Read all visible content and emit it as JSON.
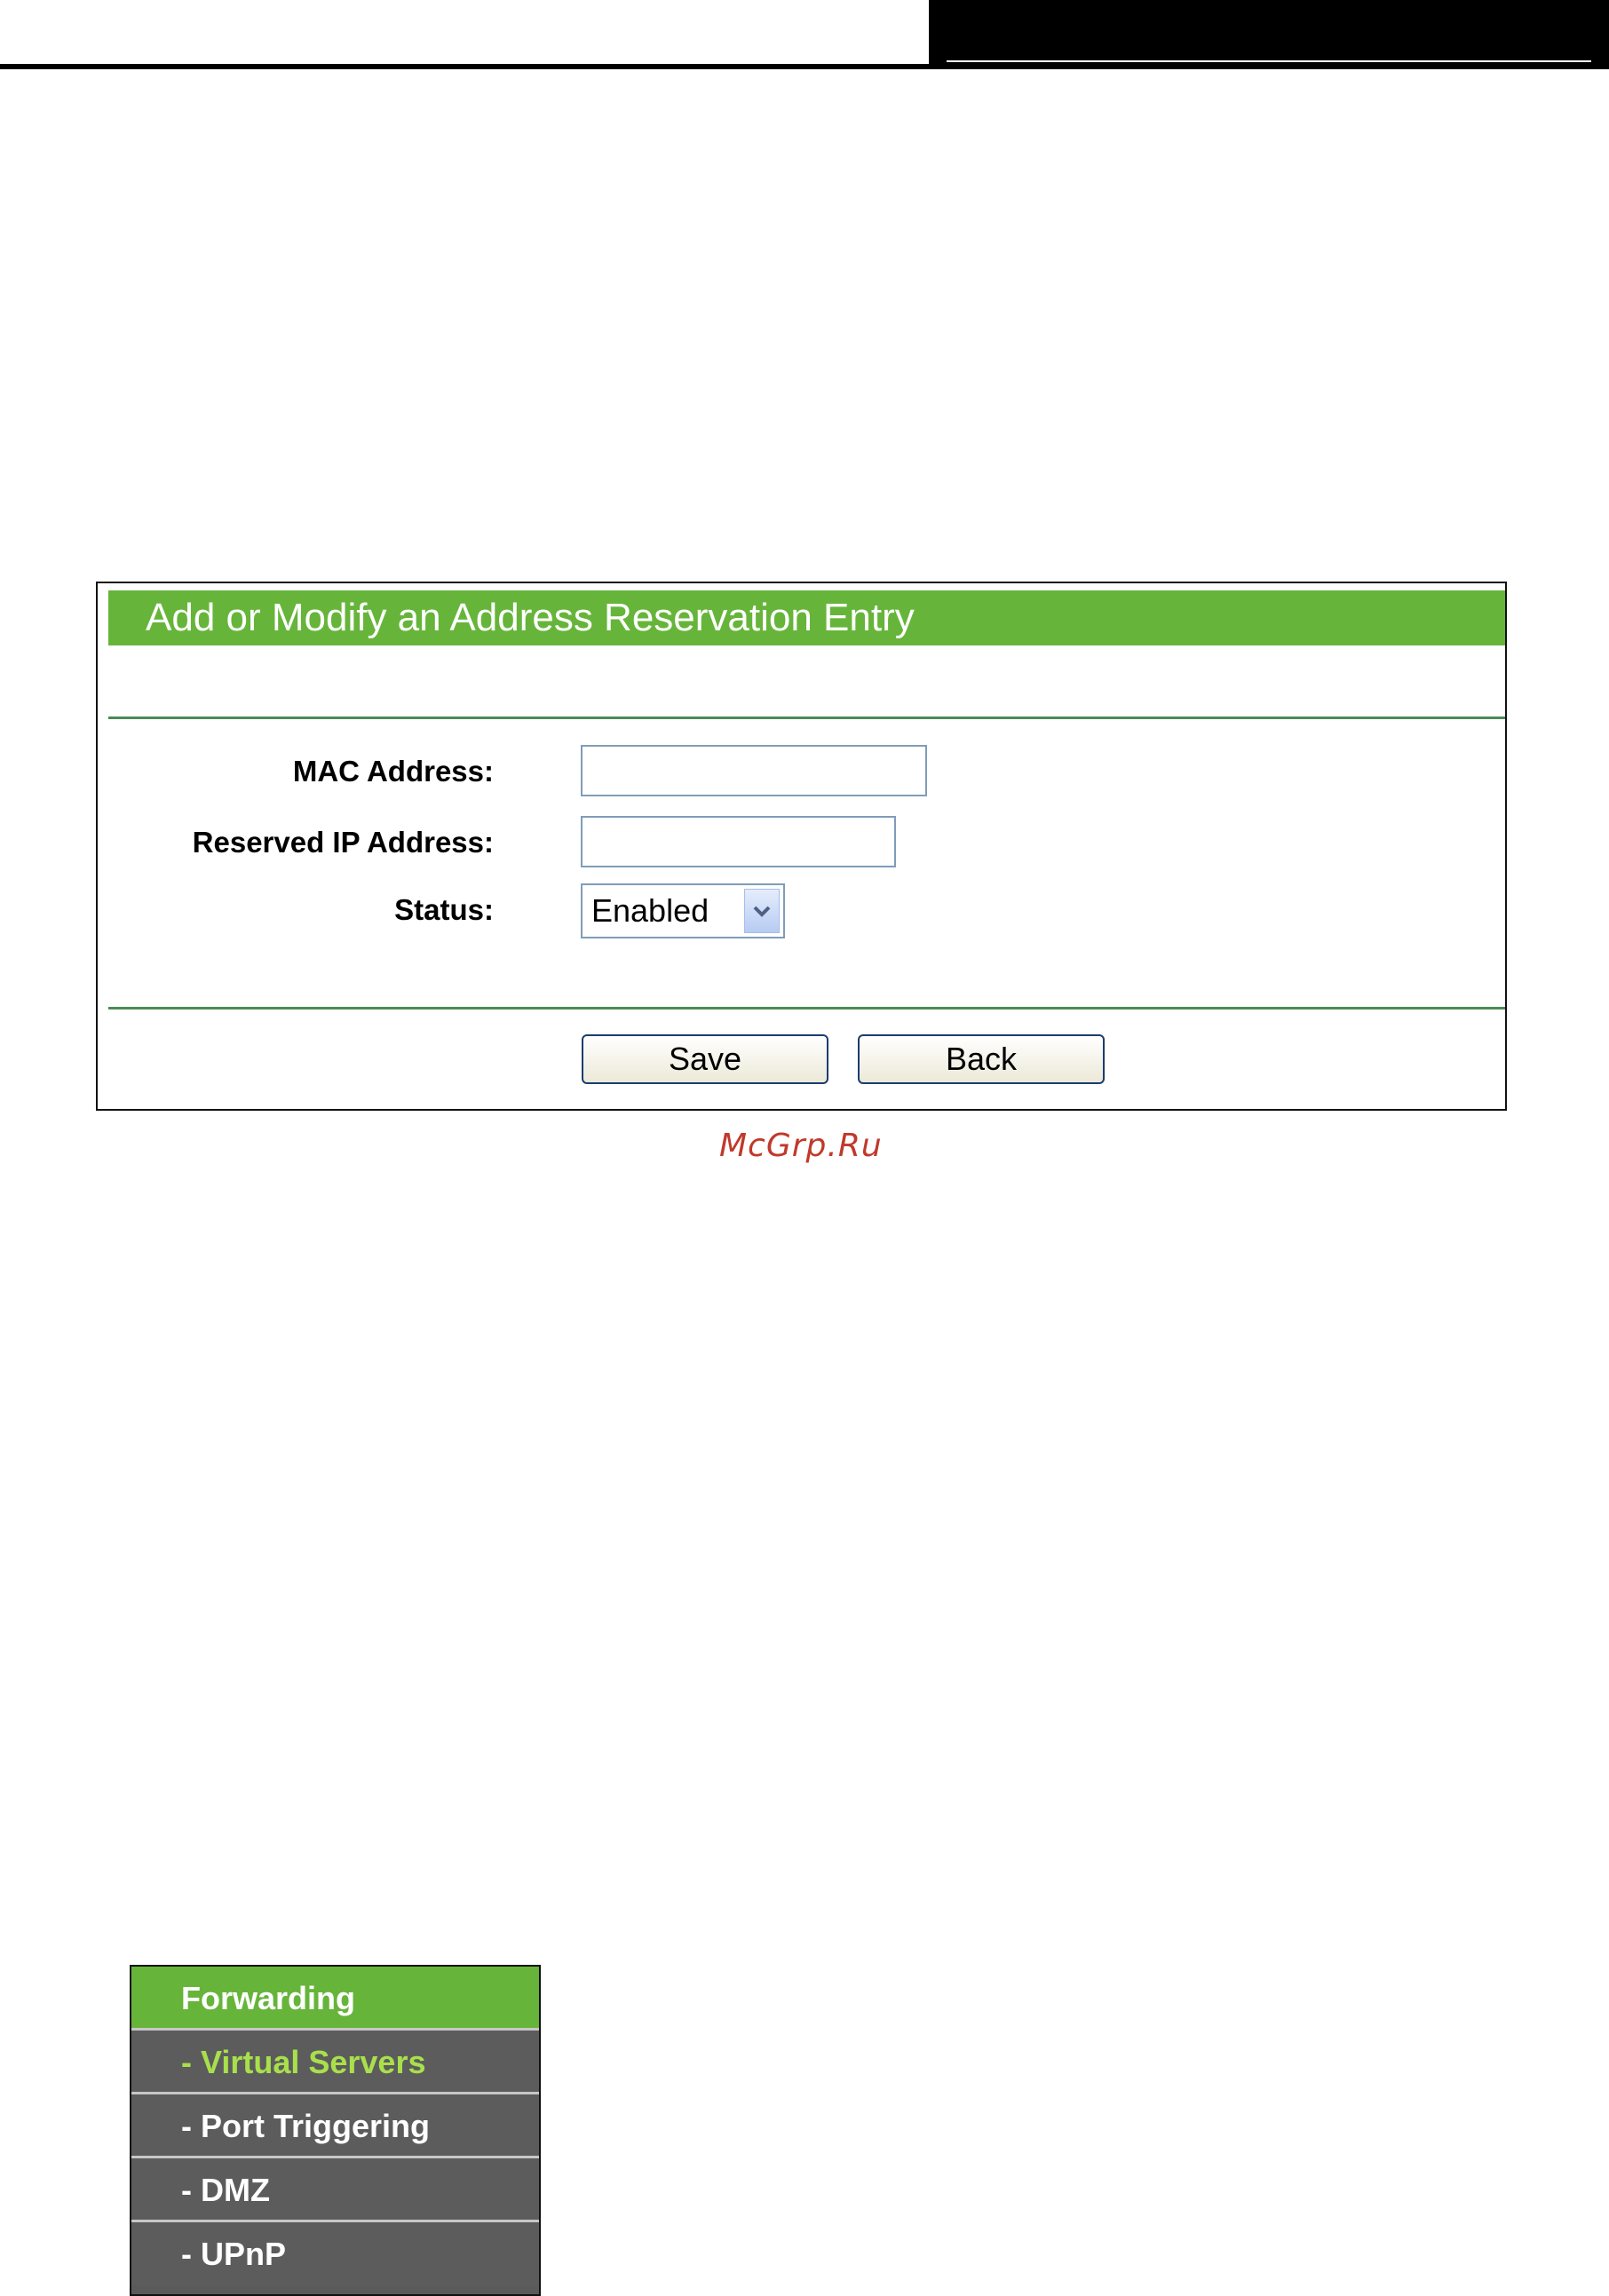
{
  "form": {
    "title": "Add or Modify an Address Reservation Entry",
    "fields": [
      {
        "label": "MAC Address:",
        "value": ""
      },
      {
        "label": "Reserved IP Address:",
        "value": ""
      },
      {
        "label": "Status:",
        "value": "Enabled"
      }
    ],
    "buttons": {
      "save": "Save",
      "back": "Back"
    }
  },
  "watermark": "McGrp.Ru",
  "menu": {
    "header": "Forwarding",
    "items": [
      {
        "label": "- Virtual Servers",
        "active": true
      },
      {
        "label": "- Port Triggering",
        "active": false
      },
      {
        "label": "- DMZ",
        "active": false
      },
      {
        "label": "- UPnP",
        "active": false
      }
    ]
  },
  "colors": {
    "accent_green": "#66b53a",
    "active_menu_text": "#a8e04b",
    "menu_bg": "#5c5c5c"
  },
  "icons": {
    "select_arrow": "chevron-down-icon"
  }
}
